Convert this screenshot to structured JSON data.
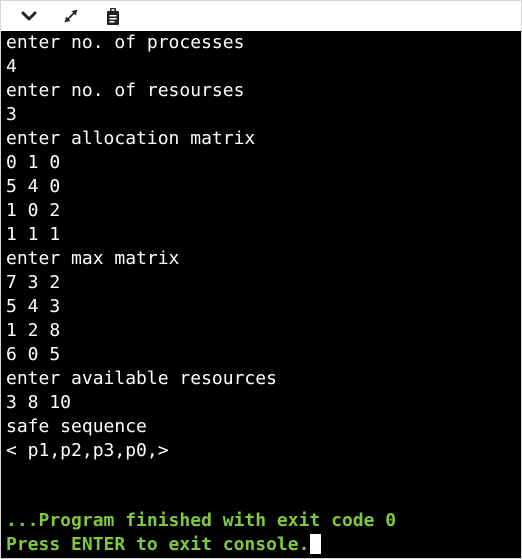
{
  "toolbar": {
    "buttons": [
      {
        "icon": "chevron-down-icon"
      },
      {
        "icon": "expand-arrows-icon"
      },
      {
        "icon": "copy-clipboard-icon"
      }
    ]
  },
  "console": {
    "lines": [
      "enter no. of processes",
      "4",
      "enter no. of resourses",
      "3",
      "enter allocation matrix",
      "0 1 0",
      "5 4 0",
      "1 0 2",
      "1 1 1",
      "enter max matrix",
      "7 3 2",
      "5 4 3",
      "1 2 8",
      "6 0 5",
      "enter available resources",
      "3 8 10",
      "safe sequence",
      "< p1,p2,p3,p0,>"
    ],
    "status_lines": [
      "...Program finished with exit code 0",
      "Press ENTER to exit console."
    ],
    "colors": {
      "background": "#000000",
      "text": "#ffffff",
      "status": "#7fc93a"
    }
  }
}
